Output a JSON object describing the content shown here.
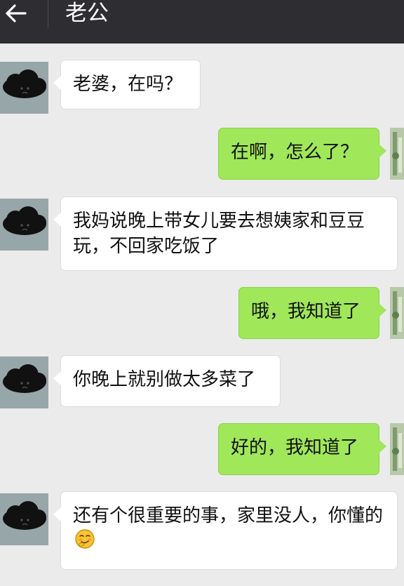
{
  "header": {
    "back_icon": "arrow-left-icon",
    "title": "老公"
  },
  "colors": {
    "header_bg": "#2e2e32",
    "chat_bg": "#ebebeb",
    "incoming_bubble": "#ffffff",
    "outgoing_bubble": "#a0e75a"
  },
  "messages": [
    {
      "side": "in",
      "text": "老婆，在吗？"
    },
    {
      "side": "out",
      "text": "在啊，怎么了？"
    },
    {
      "side": "in",
      "text": "我妈说晚上带女儿要去想姨家和豆豆玩，不回家吃饭了"
    },
    {
      "side": "out",
      "text": "哦，我知道了"
    },
    {
      "side": "in",
      "text": "你晚上就别做太多菜了"
    },
    {
      "side": "out",
      "text": "好的，我知道了"
    },
    {
      "side": "in",
      "text": "还有个很重要的事，家里没人，你懂的",
      "emoji": "shy-smirk-emoji-icon"
    }
  ]
}
